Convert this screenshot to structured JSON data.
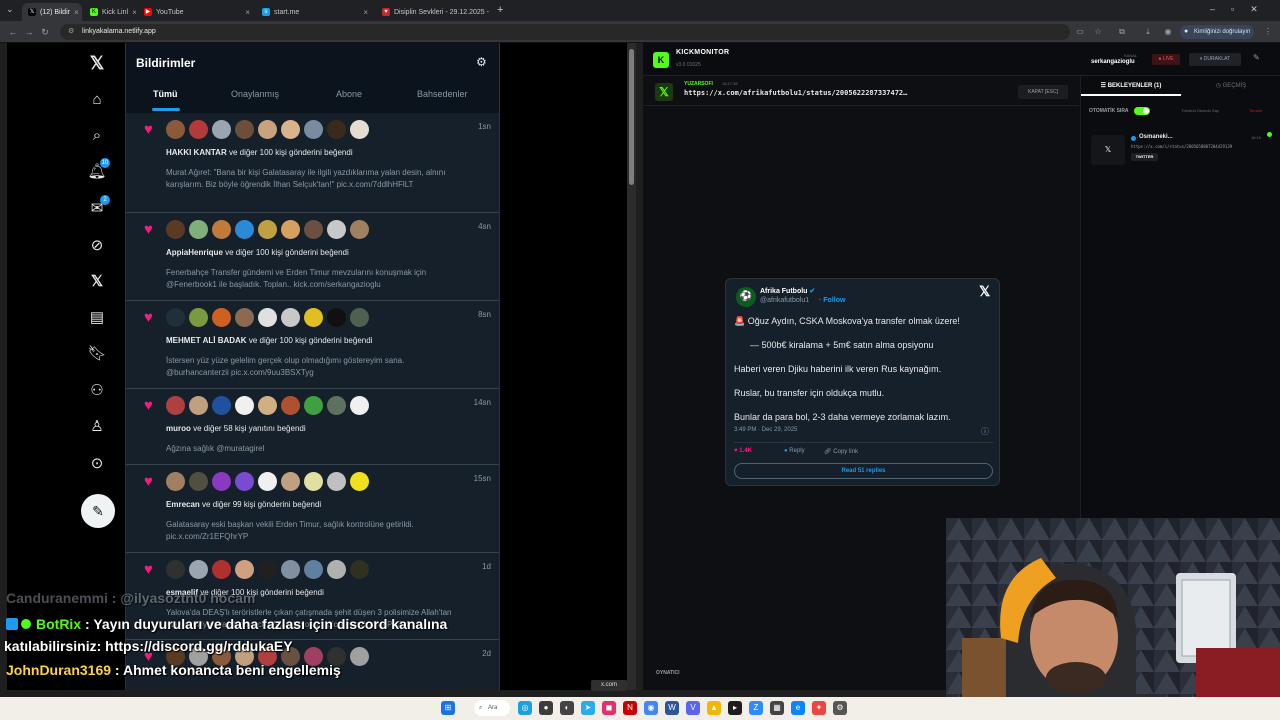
{
  "browser": {
    "tabs": [
      {
        "label": "(12) Bildir",
        "icon": "x-favicon",
        "active": true
      },
      {
        "label": "Kick Linl",
        "icon": "kick-favicon",
        "active": false
      },
      {
        "label": "YouTube",
        "icon": "youtube-favicon",
        "active": false
      },
      {
        "label": "start.me",
        "icon": "startme-favicon",
        "active": false
      },
      {
        "label": "Disiplin Sevkleri - 29.12.2025 -",
        "icon": "pdf-favicon",
        "active": false
      }
    ],
    "new_tab": "+",
    "url": "linkyakalama.netlify.app",
    "verify_button": "Kimliğinizi doğrulayın"
  },
  "x": {
    "page_title": "Bildirimler",
    "tabs": [
      "Tümü",
      "Onaylanmış",
      "Abone",
      "Bahsedenler"
    ],
    "nav_badges": {
      "notifications": "10",
      "messages": "2"
    },
    "notifications": [
      {
        "time": "1sn",
        "user": "HAKKI KANTAR",
        "action": " ve diğer 100 kişi gönderini beğendi",
        "body": "Murat Ağırel: \"Bana bir kişi Galatasaray ile ilgili yazdıklarıma yalan desin, alnını karışlarım. Biz böyle öğrendik İlhan Selçuk'tan!\" pic.x.com/7ddlhHFlLT",
        "avatars": [
          "#8a5a3b",
          "#b23a3a",
          "#9aa5b1",
          "#6b4f3a",
          "#c9a27e",
          "#d9b38c",
          "#7a8aa0",
          "#3a2a1a",
          "#e6ddd0"
        ]
      },
      {
        "time": "4sn",
        "user": "AppiaHenrique",
        "action": " ve diğer 100 kişi gönderini beğendi",
        "body": "Fenerbahçe Transfer gündemi ve Erden Timur mevzularını konuşmak için @Fenerbook1 ile başladık. Toplan.. kick.com/serkangazioglu",
        "avatars": [
          "#5a3a22",
          "#7fb07a",
          "#c07a3a",
          "#2a8ad8",
          "#c0a040",
          "#d6a060",
          "#6a5040",
          "#c8c8c8",
          "#a08060"
        ]
      },
      {
        "time": "8sn",
        "user": "MEHMET ALİ BADAK",
        "action": " ve diğer 100 kişi gönderini beğendi",
        "body": "İstersen yüz yüze gelelim gerçek olup olmadığımı göstereyim sana. @burhancanterzii pic.x.com/9uu3BSXTyg",
        "avatars": [
          "#20303a",
          "#7a9a40",
          "#d06020",
          "#8a6a50",
          "#e0e0e0",
          "#c8c8c8",
          "#e0c020",
          "#101010",
          "#506050"
        ]
      },
      {
        "time": "14sn",
        "user": "muroo",
        "action": " ve diğer 58 kişi yanıtını beğendi",
        "body": "Ağzına sağlık @muratagirel",
        "avatars": [
          "#b04040",
          "#c0a080",
          "#2050a0",
          "#f0f0f0",
          "#d0b080",
          "#b05030",
          "#40a040",
          "#607060",
          "#f0f0f0"
        ]
      },
      {
        "time": "15sn",
        "user": "Emrecan",
        "action": " ve diğer 99 kişi gönderini beğendi",
        "body": "Galatasaray eski başkan vekili Erden Timur, sağlık kontrolüne getirildi. pic.x.com/Zr1EFQhrYP",
        "avatars": [
          "#a08060",
          "#505040",
          "#8a3ac0",
          "#7a4bd0",
          "#f0f0f0",
          "#c0a080",
          "#e0e0a0",
          "#c0c0c0",
          "#f0e020"
        ]
      },
      {
        "time": "1d",
        "user": "esmaelif",
        "action": " ve diğer 100 kişi gönderini beğendi",
        "body": "Yalova'da DEAŞ'lı teröristlerle çıkan çatışmada şehit düşen 3 polisimize Allah'tan rahmet diliyor, yaralılara acil şifalar diliyorum. pic.x.com/Hx2vAPABcl",
        "avatars": [
          "#303030",
          "#9aa5b1",
          "#b03030",
          "#d0a080",
          "#202020",
          "#8090a0",
          "#6080a0",
          "#b0b0b0",
          "#303020"
        ]
      },
      {
        "time": "2d",
        "user": "",
        "action": "",
        "body": "",
        "avatars": [
          "#5a3a22",
          "#a0a0a0",
          "#8a5a3b",
          "#c0a080",
          "#b04040",
          "#6a5040",
          "#a04060",
          "#303030",
          "#a0a0a0"
        ]
      }
    ]
  },
  "kick": {
    "app_name": "KICKMONITOR",
    "version": "v3.0 01025",
    "kanal_label": "KANAL",
    "channel": "serkangazioglu",
    "live": "● LIVE",
    "pause": "⏸ DURAKLAT",
    "source_user": "YUZARSOFI",
    "source_time": "18:17:38",
    "current_url": "https://x.com/afrikafutbolu1/status/2005622287337472…",
    "close_button": "KAPAT [ESC]",
    "tab_pending": "BEKLEYENLER (1)",
    "tab_history": "GEÇMİŞ",
    "auto_label": "OTOMATİK SIRA",
    "mark_all": "Tümünü Okundu Say",
    "clear": "Temizle",
    "queue_name": "Osmaneki...",
    "queue_time": "18:16",
    "queue_url": "https://x.com/i/status/2005658807204429139",
    "queue_tag": "TWITTER",
    "player_label": "OYNATICI"
  },
  "tweet": {
    "name": "Afrika Futbolu",
    "handle": "@afrikafutbolu1",
    "follow": "Follow",
    "lines": [
      "🚨 Oğuz Aydın, CSKA Moskova'ya transfer olmak üzere!",
      "— 500b€ kiralama + 5m€ satın alma opsiyonu",
      "Haberi veren Djiku haberini ilk veren Rus kaynağım.",
      "Ruslar, bu transfer için oldukça mutlu.",
      "Bunlar da para bol, 2-3 daha vermeye zorlamak lazım."
    ],
    "date": "3:49 PM · Dec 29, 2025",
    "likes": "1.4K",
    "reply": "Reply",
    "copy": "Copy link",
    "read_more": "Read 51 replies"
  },
  "chat": [
    {
      "user": "Canduranemmi",
      "user_color": "#8a8f9a",
      "text": " : @ilyasoztnt0 hocam",
      "text_color": "#9aa0a6",
      "badges": false
    },
    {
      "user": "BotRix",
      "user_color": "#53fc18",
      "text": " : Yayın duyuruları ve daha fazlası için discord kanalına",
      "text_color": "#ffffff",
      "badges": true
    },
    {
      "user": "",
      "user_color": "#ffffff",
      "text": "katılabilirsiniz: https://discord.gg/rddukaEY",
      "text_color": "#ffffff",
      "badges": false
    },
    {
      "user": "JohnDuran3169",
      "user_color": "#ffd23f",
      "text": " : Ahmet konancta beni engellemiş",
      "text_color": "#ffffff",
      "badges": false
    }
  ],
  "overlay_text": "x.com",
  "taskbar": {
    "search": "Ara"
  }
}
